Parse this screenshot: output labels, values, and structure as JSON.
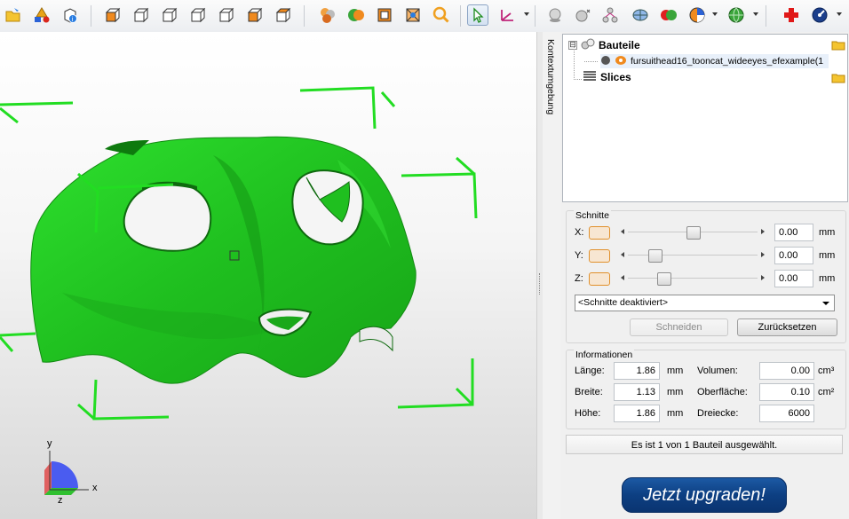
{
  "toolbar": {
    "icons": [
      "open-file-icon",
      "add-primitives-icon",
      "object-info-icon",
      "view-front-icon",
      "view-back-icon",
      "view-left-icon",
      "view-right-icon",
      "view-top-icon",
      "view-bottom-icon",
      "view-iso-icon",
      "shading-icon",
      "solid-shading-icon",
      "wireframe-icon",
      "transparent-wireframe-icon",
      "zoom-icon",
      "select-arrow-icon",
      "measure-axes-icon",
      "add-shape-icon",
      "separate-shells-icon",
      "node-tree-icon",
      "mesh-detail-icon",
      "boolean-icon",
      "pie-analysis-icon",
      "globe-download-icon",
      "repair-cross-icon",
      "quality-gauge-icon"
    ],
    "colors": {
      "accent_green": "#1fd41f",
      "repair_red": "#e01818"
    }
  },
  "viewport": {
    "model_color": "#22cc22",
    "selection_bracket_color": "#22dd22",
    "axes": {
      "x": "x",
      "y": "y",
      "z": "z"
    }
  },
  "sidebar": {
    "vertical_tab": "Kontextumgebung",
    "tree": {
      "root_expander": "⊟",
      "parts_label": "Bauteile",
      "part_item": "fursuithead16_tooncat_wideeyes_efexample(1",
      "slices_label": "Slices"
    },
    "cuts": {
      "title": "Schnitte",
      "axes": [
        {
          "label": "X:",
          "value": "0.00",
          "unit": "mm",
          "position": 0.5
        },
        {
          "label": "Y:",
          "value": "0.00",
          "unit": "mm",
          "position": 0.2
        },
        {
          "label": "Z:",
          "value": "0.00",
          "unit": "mm",
          "position": 0.3
        }
      ],
      "mode_select": "<Schnitte deaktiviert>",
      "cut_button": "Schneiden",
      "reset_button": "Zurücksetzen"
    },
    "info": {
      "title": "Informationen",
      "length_label": "Länge:",
      "length_value": "1.86",
      "length_unit": "mm",
      "width_label": "Breite:",
      "width_value": "1.13",
      "width_unit": "mm",
      "height_label": "Höhe:",
      "height_value": "1.86",
      "height_unit": "mm",
      "volume_label": "Volumen:",
      "volume_value": "0.00",
      "volume_unit": "cm³",
      "surface_label": "Oberfläche:",
      "surface_value": "0.10",
      "surface_unit": "cm²",
      "triangles_label": "Dreiecke:",
      "triangles_value": "6000"
    },
    "status_text": "Es ist 1 von 1 Bauteil ausgewählt.",
    "upgrade_button": "Jetzt upgraden!"
  }
}
